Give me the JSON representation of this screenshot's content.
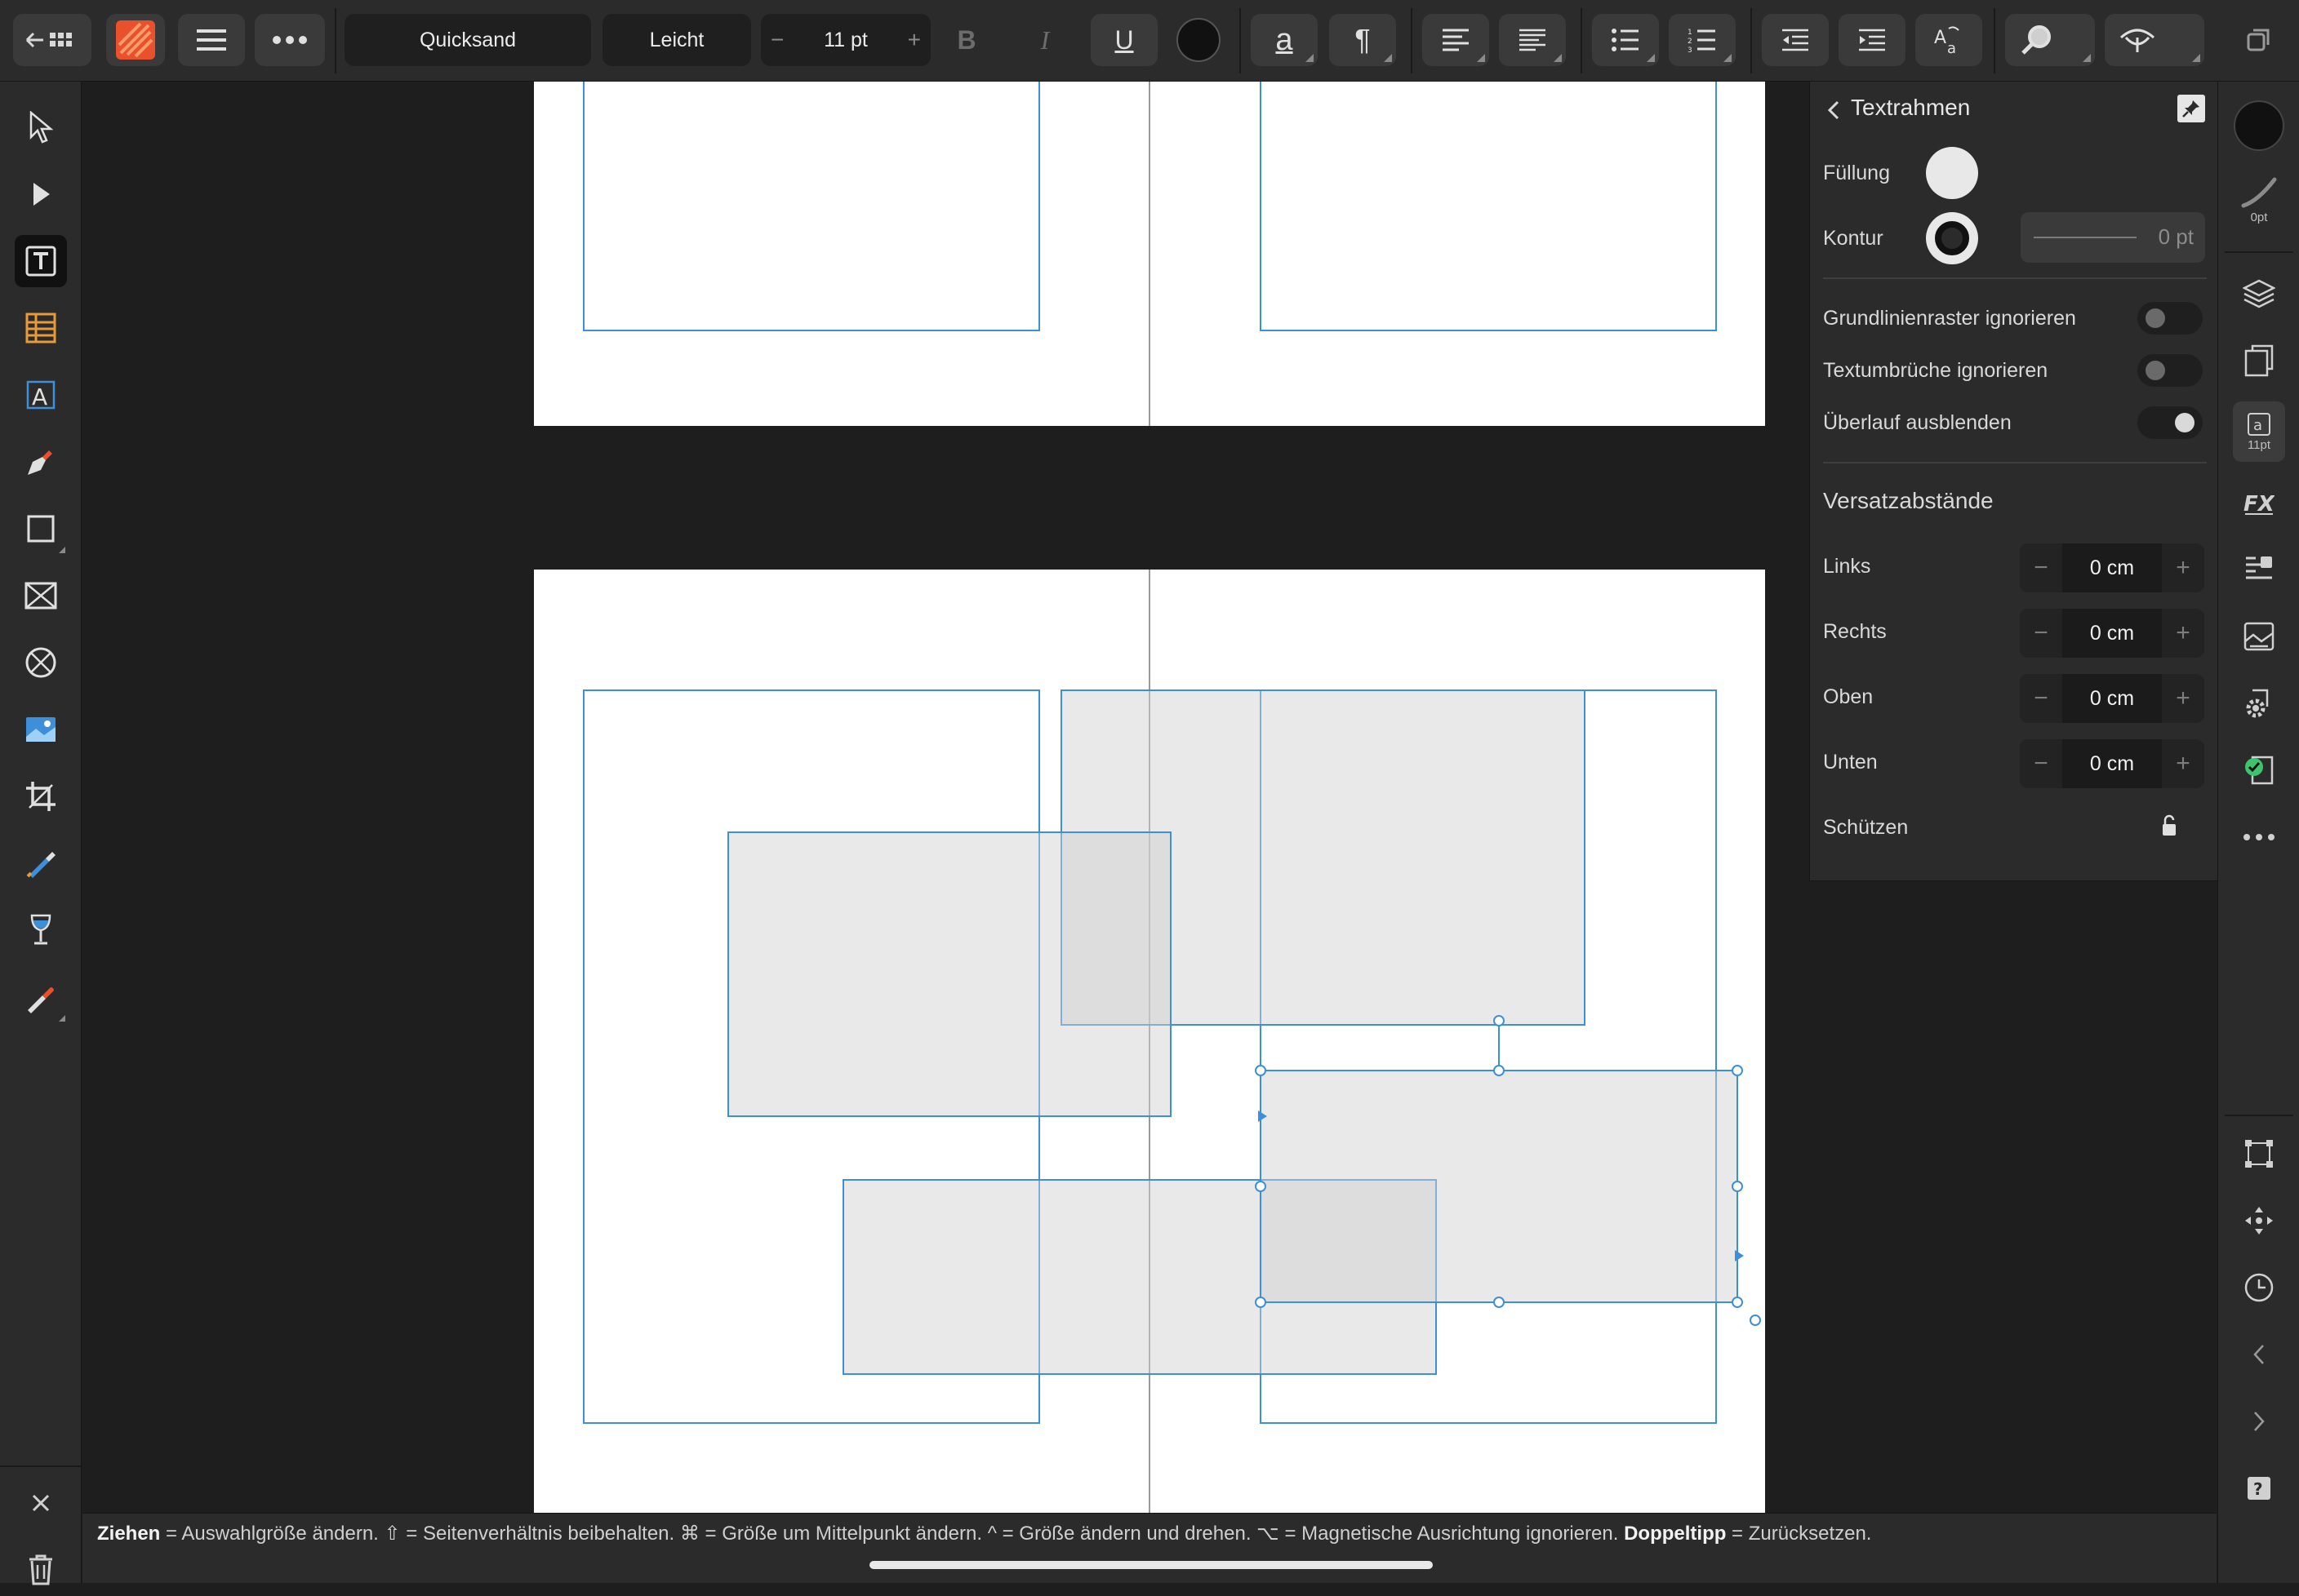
{
  "toolbar": {
    "font_family": "Quicksand",
    "font_style": "Leicht",
    "font_size": "11 pt",
    "decrease_label": "−",
    "increase_label": "+",
    "bold_label": "B",
    "italic_label": "I",
    "underline_label": "U",
    "text_style_label": "a",
    "pilcrow_label": "¶",
    "text_color": "#111111"
  },
  "panel": {
    "title": "Textrahmen",
    "fill_label": "Füllung",
    "fill_color": "#e8e8e8",
    "stroke_label": "Kontur",
    "stroke_value": "0 pt",
    "ignore_baseline_grid": "Grundlinienraster ignorieren",
    "ignore_text_wrap": "Textumbrüche ignorieren",
    "hide_overflow": "Überlauf ausblenden",
    "insets_heading": "Versatzabstände",
    "insets": [
      {
        "label": "Links",
        "value": "0 cm"
      },
      {
        "label": "Rechts",
        "value": "0 cm"
      },
      {
        "label": "Oben",
        "value": "0 cm"
      },
      {
        "label": "Unten",
        "value": "0 cm"
      }
    ],
    "protect_label": "Schützen",
    "toggles": {
      "ignore_baseline_grid": false,
      "ignore_text_wrap": false,
      "hide_overflow": true
    }
  },
  "studio": {
    "stroke_width_label": "0pt",
    "char_size_label": "11pt"
  },
  "status": {
    "drag_key": "Ziehen",
    "drag_desc": " = Auswahlgröße ändern. ⇧ = Seitenverhältnis beibehalten. ⌘ = Größe um Mittelpunkt ändern. ^ = Größe ändern und drehen. ⌥ = Magnetische Ausrichtung ignorieren. ",
    "double_tap_key": "Doppeltipp",
    "double_tap_desc": " = Zurücksetzen."
  },
  "colors": {
    "accent": "#3d8fd9",
    "app_icon": "#e8512c",
    "success": "#3ec46d"
  },
  "icons": {
    "left_tools": [
      "move-tool-icon",
      "node-tool-icon",
      "frame-text-tool-icon",
      "table-tool-icon",
      "artistic-text-tool-icon",
      "pen-tool-icon",
      "rectangle-tool-icon",
      "picture-frame-rect-icon",
      "picture-frame-ellipse-icon",
      "place-image-icon",
      "crop-tool-icon",
      "fill-tool-icon",
      "transparency-tool-icon",
      "color-picker-icon"
    ],
    "right_tools": [
      "color-icon",
      "stroke-icon",
      "layers-icon",
      "pages-icon",
      "character-icon",
      "effects-icon",
      "text-styles-icon",
      "resource-manager-icon",
      "preflight-settings-icon",
      "preflight-ok-icon",
      "more-icon",
      "transform-icon",
      "navigator-icon",
      "history-icon",
      "collapse-left-icon",
      "expand-right-icon",
      "help-icon"
    ]
  }
}
